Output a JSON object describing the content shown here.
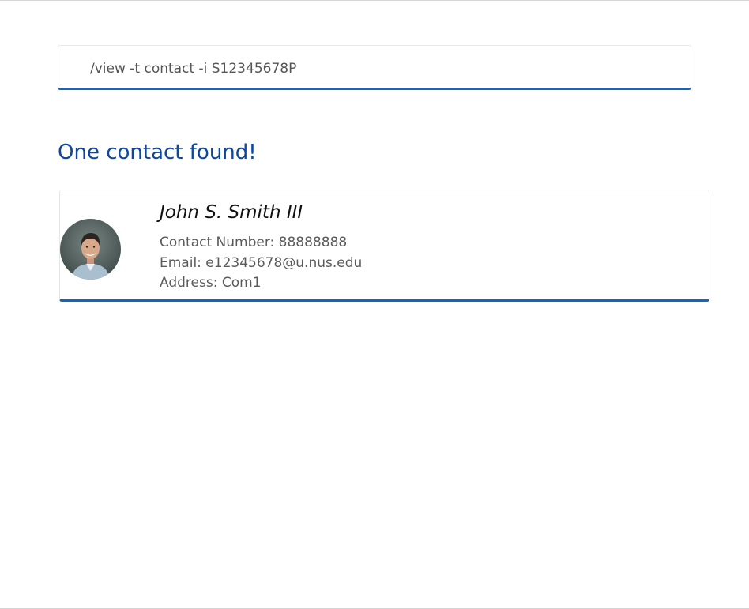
{
  "command_input": {
    "value": "/view -t contact -i S12345678P"
  },
  "result": {
    "heading": "One contact found!"
  },
  "contact": {
    "name": "John S. Smith III",
    "phone_line": "Contact Number: 88888888",
    "email_line": "Email: e12345678@u.nus.edu",
    "address_line": "Address: Com1",
    "avatar_icon": "person-photo-icon"
  },
  "colors": {
    "accent": "#1565c0",
    "heading": "#0d47a1",
    "text_muted": "#5a5a5a"
  }
}
